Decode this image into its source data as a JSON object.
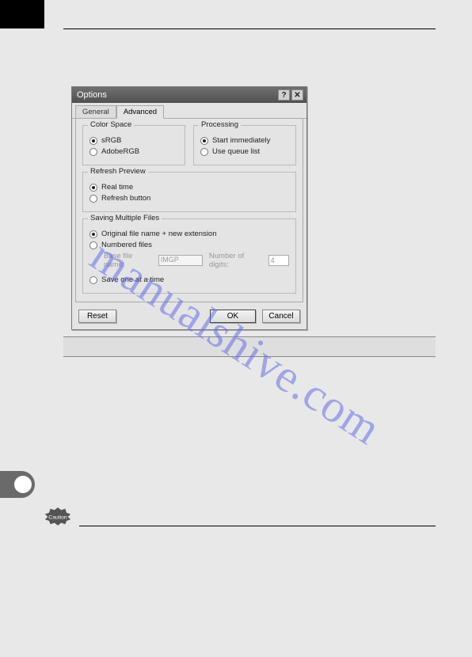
{
  "watermark": "manualshive.com",
  "dialog": {
    "title": "Options",
    "tabs": {
      "general": "General",
      "advanced": "Advanced",
      "active": "advanced"
    },
    "color_space": {
      "legend": "Color Space",
      "srgb": "sRGB",
      "adobergb": "AdobeRGB",
      "selected": "srgb"
    },
    "processing": {
      "legend": "Processing",
      "start_immediately": "Start immediately",
      "use_queue": "Use queue list",
      "selected": "start_immediately"
    },
    "refresh_preview": {
      "legend": "Refresh Preview",
      "real_time": "Real time",
      "refresh_button": "Refresh button",
      "selected": "real_time"
    },
    "saving": {
      "legend": "Saving Multiple Files",
      "original": "Original file name + new extension",
      "numbered": "Numbered files",
      "base_label": "Base file name:",
      "base_value": "IMGP",
      "digits_label": "Number of digits:",
      "digits_value": "4",
      "save_one": "Save one at a time",
      "selected": "original"
    },
    "buttons": {
      "reset": "Reset",
      "ok": "OK",
      "cancel": "Cancel"
    },
    "help_glyph": "?",
    "close_glyph": "✕"
  },
  "caution_label": "Caution"
}
